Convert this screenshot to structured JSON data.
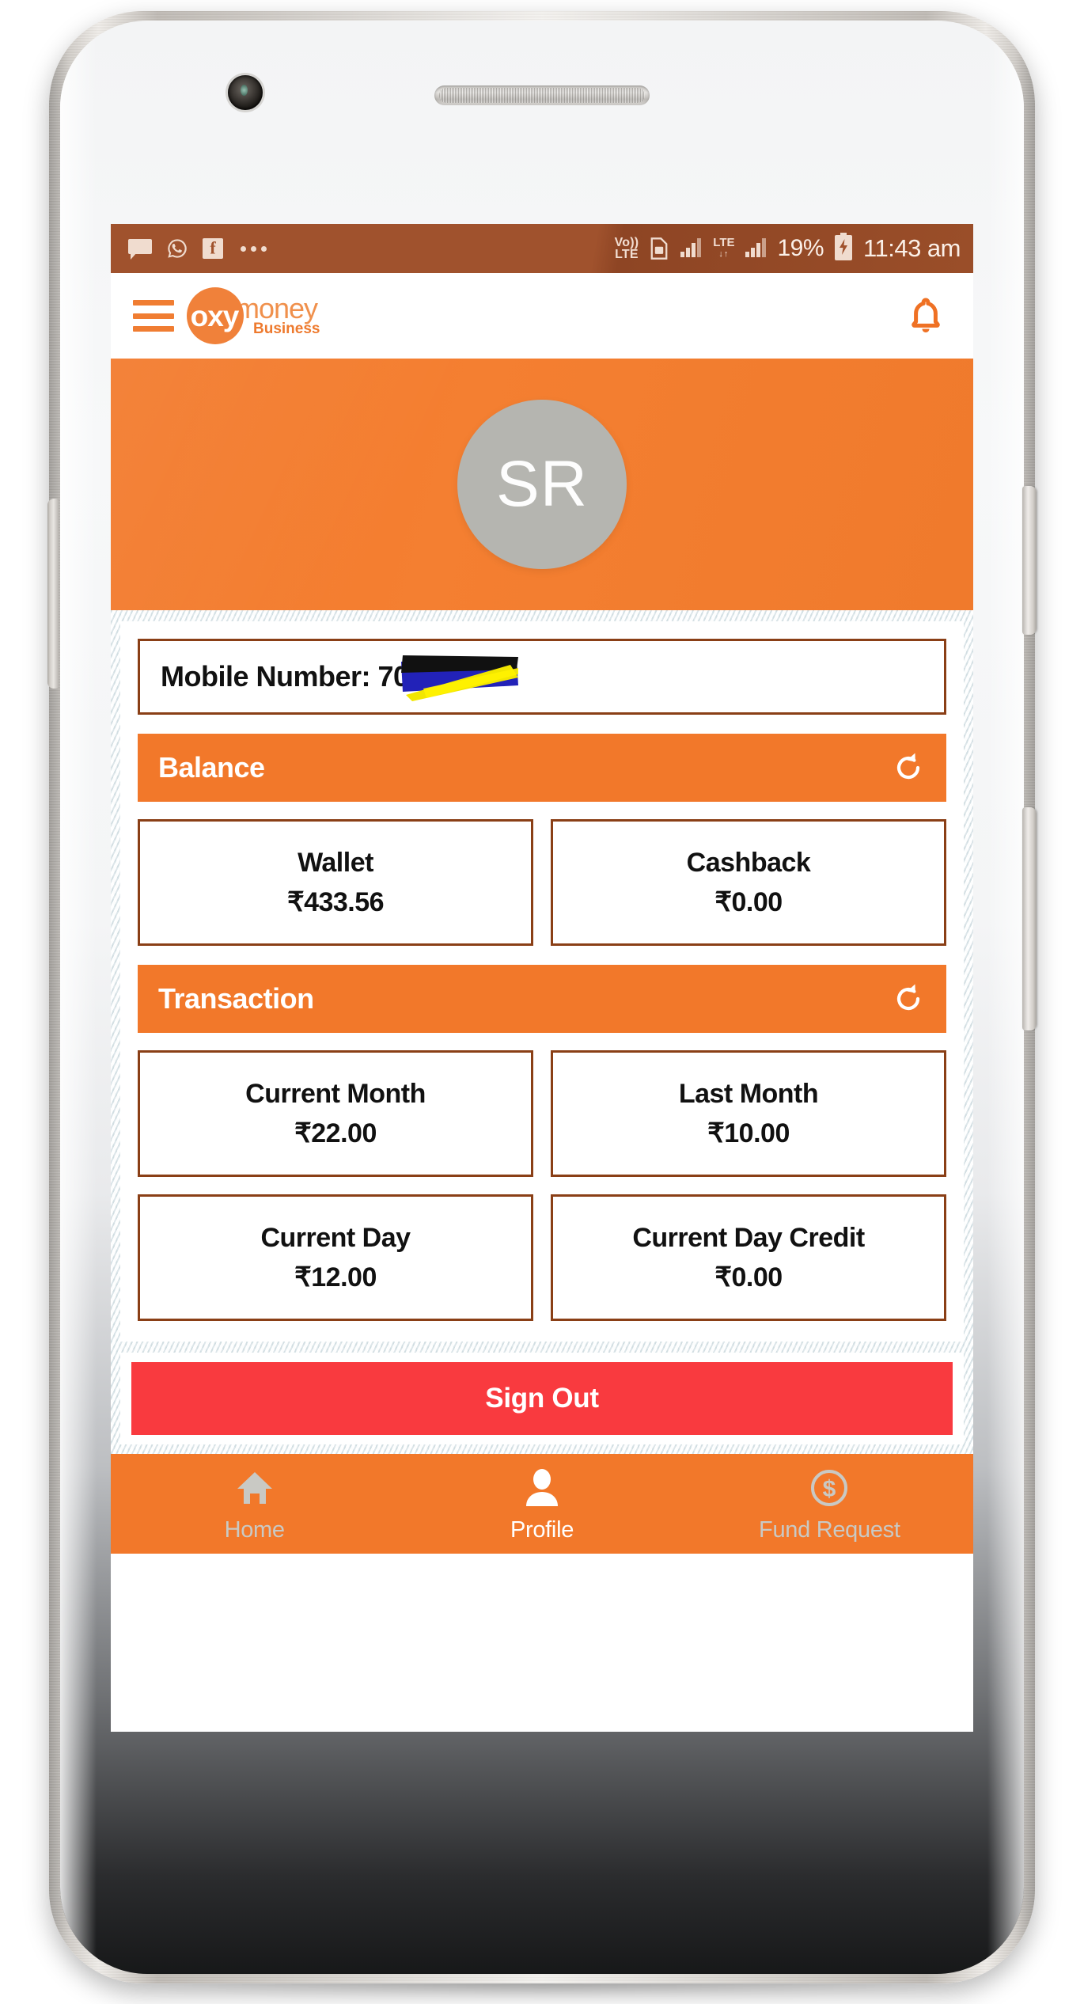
{
  "status_bar": {
    "notification_icons": [
      "sms-icon",
      "whatsapp-icon",
      "facebook-icon",
      "more-notifications-icon"
    ],
    "volte_line1": "Vo))",
    "volte_line2": "LTE",
    "network_label": "LTE",
    "network_sub": "↓↑",
    "battery_percent": "19%",
    "time": "11:43 am",
    "background_color": "#a0522d"
  },
  "app_bar": {
    "menu_icon": "hamburger-menu-icon",
    "logo": {
      "mark": "oxy",
      "word": "money",
      "tagline": "Business"
    },
    "notification_icon": "bell-icon"
  },
  "profile_banner": {
    "avatar_initials": "SR",
    "banner_color": "#f2782a",
    "avatar_color": "#b5b5b0"
  },
  "mobile_number": {
    "label": "Mobile Number: 70",
    "redacted": true
  },
  "balance": {
    "section_title": "Balance",
    "refresh_icon": "refresh-icon",
    "cards": [
      {
        "name": "Wallet",
        "value": "₹433.56"
      },
      {
        "name": "Cashback",
        "value": "₹0.00"
      }
    ]
  },
  "transaction": {
    "section_title": "Transaction",
    "refresh_icon": "refresh-icon",
    "cards": [
      {
        "name": "Current Month",
        "value": "₹22.00"
      },
      {
        "name": "Last Month",
        "value": "₹10.00"
      },
      {
        "name": "Current Day",
        "value": "₹12.00"
      },
      {
        "name": "Current Day Credit",
        "value": "₹0.00"
      }
    ]
  },
  "sign_out": {
    "label": "Sign Out",
    "color": "#f93a3f"
  },
  "bottom_nav": {
    "items": [
      {
        "label": "Home",
        "icon": "home-icon",
        "active": false
      },
      {
        "label": "Profile",
        "icon": "person-icon",
        "active": true
      },
      {
        "label": "Fund Request",
        "icon": "dollar-circle-icon",
        "active": false
      }
    ],
    "background_color": "#f2782a",
    "active_color": "#ffffff",
    "inactive_color": "#c9c9c4"
  },
  "theme": {
    "brand_orange": "#f2782a",
    "card_border": "#8a3f16",
    "status_bar_brown": "#a0522d"
  }
}
